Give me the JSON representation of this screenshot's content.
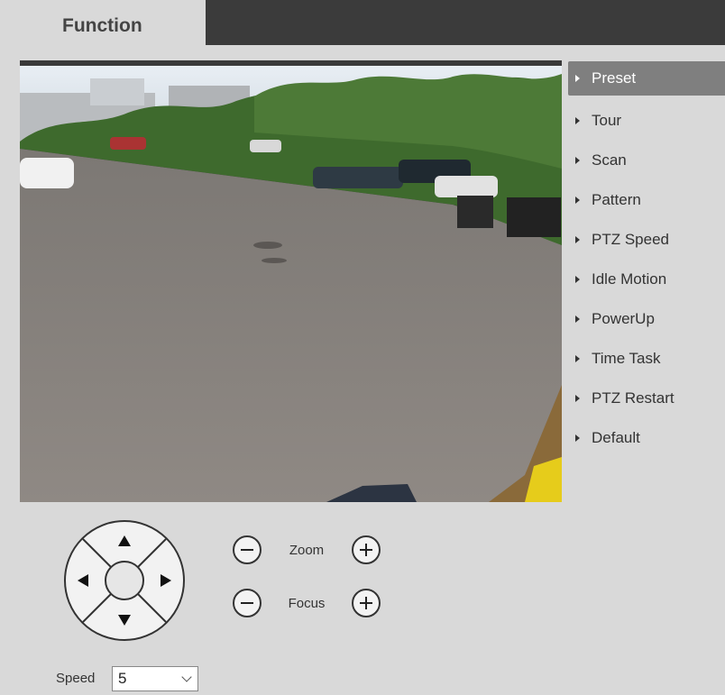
{
  "header": {
    "tab_label": "Function"
  },
  "menu": {
    "items": [
      {
        "label": "Preset",
        "active": true
      },
      {
        "label": "Tour",
        "active": false
      },
      {
        "label": "Scan",
        "active": false
      },
      {
        "label": "Pattern",
        "active": false
      },
      {
        "label": "PTZ Speed",
        "active": false
      },
      {
        "label": "Idle Motion",
        "active": false
      },
      {
        "label": "PowerUp",
        "active": false
      },
      {
        "label": "Time Task",
        "active": false
      },
      {
        "label": "PTZ Restart",
        "active": false
      },
      {
        "label": "Default",
        "active": false
      }
    ]
  },
  "controls": {
    "zoom_label": "Zoom",
    "focus_label": "Focus",
    "speed_label": "Speed",
    "speed_value": "5"
  },
  "colors": {
    "background": "#d9d9d9",
    "dark_strip": "#3b3b3b",
    "active_menu": "#7f7f7f"
  }
}
